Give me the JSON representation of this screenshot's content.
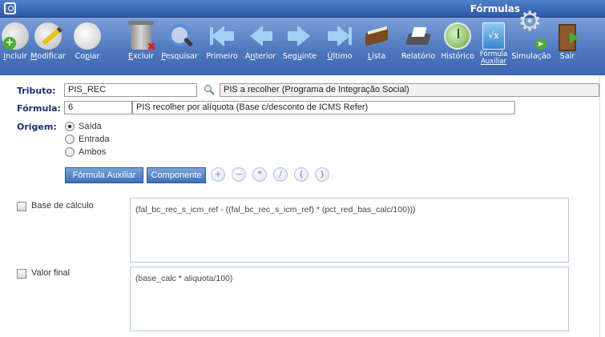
{
  "window": {
    "title": "Fórmulas"
  },
  "toolbar": {
    "incluir": {
      "first": "I",
      "rest": "ncluir"
    },
    "modificar": {
      "first": "M",
      "rest": "odificar"
    },
    "copiar": {
      "pre": "Co",
      "u": "p",
      "post": "iar"
    },
    "excluir": {
      "first": "E",
      "rest": "xcluir"
    },
    "pesquisar": {
      "first": "P",
      "rest": "esquisar"
    },
    "primeiro": "Primeiro",
    "anterior": {
      "first": "A",
      "u": "n",
      "post": "terior"
    },
    "seguinte": {
      "pre": "Seg",
      "u": "u",
      "post": "inte"
    },
    "ultimo": {
      "first": "Ú",
      "rest": "ltimo"
    },
    "lista": {
      "first": "L",
      "rest": "ista"
    },
    "relatorio": "Relatório",
    "historico": "Histórico",
    "formula_auxiliar_1": "Fórmula",
    "formula_auxiliar_2": "Auxiliar",
    "formula_icon_text": "√x",
    "simulacao": "Simulação",
    "sair": "Sair"
  },
  "form": {
    "tributo_label": "Tributo:",
    "tributo_code": "PIS_REC",
    "tributo_desc": "PIS a recolher (Programa de Integração Social)",
    "formula_label": "Fórmula:",
    "formula_code": "6",
    "formula_desc": "PIS recolher por alíquota (Base c/desconto de ICMS Refer)",
    "origem_label": "Origem:",
    "origem_options": [
      "Saída",
      "Entrada",
      "Ambos"
    ],
    "origem_selected": "Saída"
  },
  "buttons": {
    "formula_auxiliar": "Fórmula Auxiliar",
    "componente": "Componente",
    "ops": [
      "+",
      "−",
      "*",
      "/",
      "(",
      ")"
    ]
  },
  "base_calculo": {
    "label": "Base de cálculo",
    "expression": "(fal_bc_rec_s_icm_ref - ((fal_bc_rec_s_icm_ref) * (pct_red_bas_calc/100)))"
  },
  "valor_final": {
    "label": "Valor final",
    "expression": "(base_calc * aliquota/100)"
  }
}
